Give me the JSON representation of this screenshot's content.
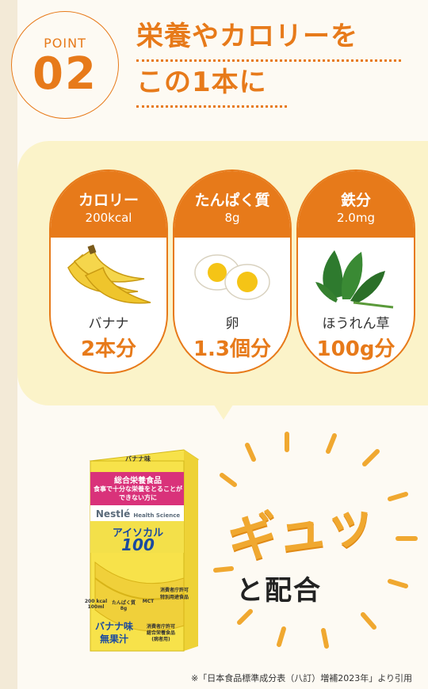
{
  "point": {
    "label": "POINT",
    "number": "02"
  },
  "headline": {
    "line1": "栄養やカロリーを",
    "line2": "この1本に"
  },
  "cards": [
    {
      "name": "カロリー",
      "amount": "200kcal",
      "food": "バナナ",
      "equivalent": "2本分",
      "icon": "banana-icon"
    },
    {
      "name": "たんぱく質",
      "amount": "8g",
      "food": "卵",
      "equivalent": "1.3個分",
      "icon": "egg-icon"
    },
    {
      "name": "鉄分",
      "amount": "2.0mg",
      "food": "ほうれん草",
      "equivalent": "100g分",
      "icon": "spinach-icon"
    }
  ],
  "product": {
    "category": "総合栄養食品",
    "tagline1": "食事で十分な栄養をとることが",
    "tagline2": "できない方に",
    "brand": "Nestlé",
    "brand_sub": "Health Science",
    "name_kana": "アイソカル",
    "name_num": "100",
    "flavor1": "バナナ味",
    "flavor2": "無果汁",
    "flavor_top": "バナナ味",
    "stat1": "200 kcal 100ml",
    "stat2": "たんぱく質 8g",
    "stat3": "MCT",
    "seal_text": "消費者庁許可 特別用途食品",
    "approval1": "消費者庁許可",
    "approval2": "総合栄養食品",
    "approval3": "(病者用)"
  },
  "emphasis": {
    "big": "ギュッ",
    "small": "と配合"
  },
  "footnote": "※「日本食品標準成分表（八訂）増補2023年」より引用",
  "colors": {
    "accent": "#e77a1a",
    "bubble": "#fbf3c9",
    "giyu": "#f0a830"
  }
}
